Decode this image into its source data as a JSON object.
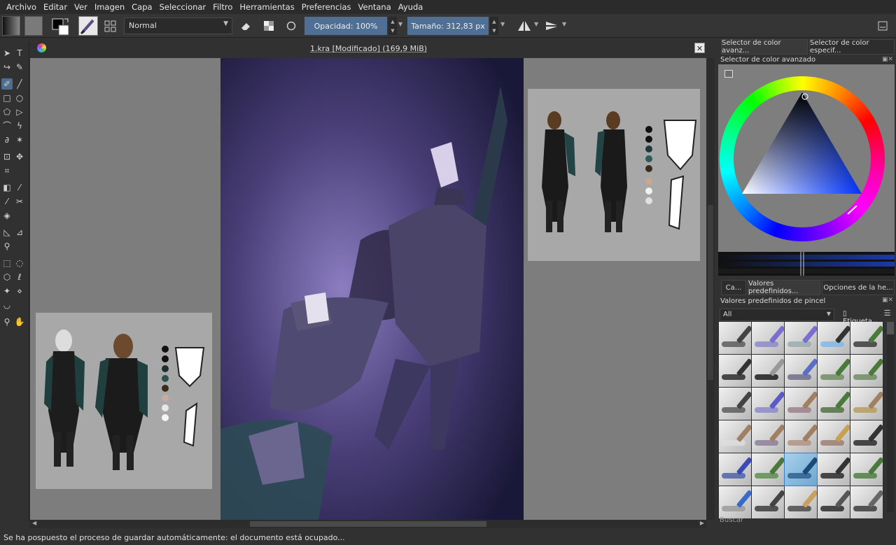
{
  "menubar": [
    "Archivo",
    "Editar",
    "Ver",
    "Imagen",
    "Capa",
    "Seleccionar",
    "Filtro",
    "Herramientas",
    "Preferencias",
    "Ventana",
    "Ayuda"
  ],
  "toolbar": {
    "blend_mode": "Normal",
    "opacity_label": "Opacidad:  100%",
    "size_label": "Tamaño:  312,83 px"
  },
  "document": {
    "title": "1.kra [Modificado]  (169,9 MiB)"
  },
  "dock": {
    "tab1": "Selector de color avanz...",
    "tab2": "Selector de color especif...",
    "color_panel_title": "Selector de color avanzado",
    "presets_tab1": "Ca...",
    "presets_tab2": "Valores predefinidos...",
    "presets_tab3": "Opciones de la he...",
    "presets_title": "Valores predefinidos de pincel",
    "filter_value": "All",
    "tag_label": "Etiqueta",
    "search_placeholder": "Buscar"
  },
  "status": {
    "message": "Se ha pospuesto el proceso de guardar automáticamente: el documento está ocupado..."
  },
  "colors": {
    "accent": "#4f6f94",
    "selected_preset": "#8fc0e2"
  }
}
